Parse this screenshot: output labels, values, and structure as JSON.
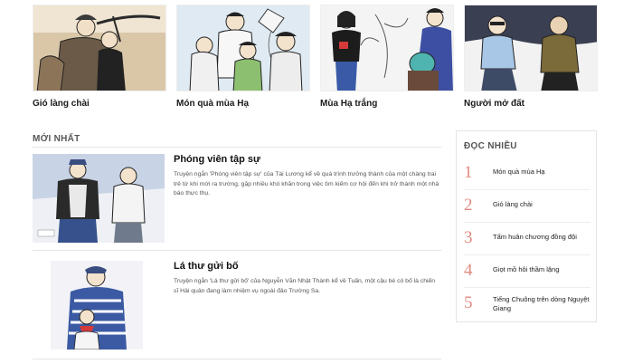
{
  "featured": [
    {
      "caption": "Gió làng chài",
      "thumb_icon": "fisherman-illustration"
    },
    {
      "caption": "Món quà mùa Hạ",
      "thumb_icon": "children-kite-illustration"
    },
    {
      "caption": "Mùa Hạ trắng",
      "thumb_icon": "women-plants-illustration"
    },
    {
      "caption": "Người mở đất",
      "thumb_icon": "two-men-talking-illustration"
    }
  ],
  "latest": {
    "section_label": "MỚI NHẤT",
    "articles": [
      {
        "title": "Phóng viên tập sự",
        "description": "Truyện ngắn 'Phóng viên tập sự' của Tài Lương kể về quá trình trưởng thành của một chàng trai trẻ từ khi mới ra trường, gặp nhiều khó khăn trong việc tìm kiếm cơ hội đến khi trở thành một nhà báo thực thụ."
      },
      {
        "title": "Lá thư gửi bố",
        "description": "Truyện ngắn 'Lá thư gửi bố' của Nguyễn Văn Nhật Thành kể về Tuấn, một cậu bé có bố là chiến sĩ Hải quân đang làm nhiệm vụ ngoài đảo Trường Sa."
      }
    ]
  },
  "most_read": {
    "title": "ĐỌC NHIỀU",
    "items": [
      {
        "num": "1",
        "label": "Món quà mùa Hạ"
      },
      {
        "num": "2",
        "label": "Gió làng chài"
      },
      {
        "num": "3",
        "label": "Tấm huân chương đồng đội"
      },
      {
        "num": "4",
        "label": "Giọt mồ hôi thầm lặng"
      },
      {
        "num": "5",
        "label": "Tiếng Chuông trên dòng Nguyệt Giang"
      }
    ]
  },
  "colors": {
    "accent_number": "#e08a80",
    "rule": "#e5e5e5",
    "section_label": "#555555"
  }
}
